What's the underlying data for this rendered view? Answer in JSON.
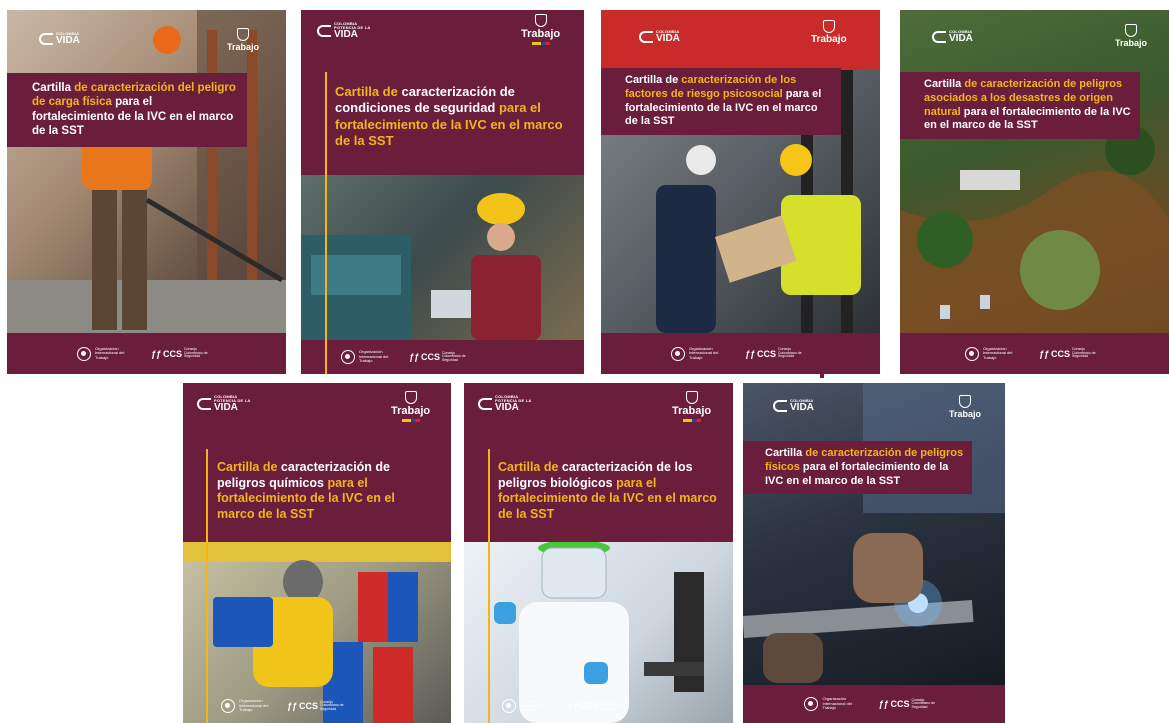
{
  "brand": {
    "country_line1": "COLOMBIA",
    "country_line2": "POTENCIA DE LA",
    "vida": "VIDA",
    "ministry": "Trabajo"
  },
  "footer": {
    "oit": "Organización Internacional del Trabajo",
    "ccs": "CCS",
    "ccs_full": "Consejo Colombiano de Seguridad"
  },
  "covers": [
    {
      "id": "carga-fisica",
      "title_parts": [
        {
          "text": "Cartilla ",
          "accent": false
        },
        {
          "text": "de caracterización del peligro de carga física",
          "accent": true
        },
        {
          "text": " para el fortalecimiento de la IVC en el marco de la SST",
          "accent": false
        }
      ]
    },
    {
      "id": "condiciones-seguridad",
      "title_parts": [
        {
          "text": "Cartilla de",
          "accent": true
        },
        {
          "text": " caracterización de condiciones de seguridad ",
          "accent": false
        },
        {
          "text": "para el fortalecimiento de la IVC en el marco de la SST",
          "accent": true
        }
      ]
    },
    {
      "id": "psicosocial",
      "title_parts": [
        {
          "text": "Cartilla de ",
          "accent": false
        },
        {
          "text": "caracterización de los factores de riesgo psicosocial",
          "accent": true
        },
        {
          "text": " para el fortalecimiento de la IVC en el marco de la SST",
          "accent": false
        }
      ]
    },
    {
      "id": "desastres-naturales",
      "title_parts": [
        {
          "text": "Cartilla ",
          "accent": false
        },
        {
          "text": "de caracterización de peligros asociados a los desastres de origen natural",
          "accent": true
        },
        {
          "text": " para el fortalecimiento de la IVC en el marco de la SST",
          "accent": false
        }
      ]
    },
    {
      "id": "quimicos",
      "title_parts": [
        {
          "text": "Cartilla de",
          "accent": true
        },
        {
          "text": " caracterización de peligros químicos ",
          "accent": false
        },
        {
          "text": "para el fortalecimiento de la IVC en el marco de la SST",
          "accent": true
        }
      ]
    },
    {
      "id": "biologicos",
      "title_parts": [
        {
          "text": "Cartilla de",
          "accent": true
        },
        {
          "text": " caracterización de los peligros biológicos ",
          "accent": false
        },
        {
          "text": "para el fortalecimiento de la IVC en el marco de la SST",
          "accent": true
        }
      ]
    },
    {
      "id": "fisicos",
      "title_parts": [
        {
          "text": "Cartilla ",
          "accent": false
        },
        {
          "text": "de caracterización de peligros físicos",
          "accent": true
        },
        {
          "text": " para el fortalecimiento de la IVC en el marco de la SST",
          "accent": false
        }
      ]
    }
  ]
}
